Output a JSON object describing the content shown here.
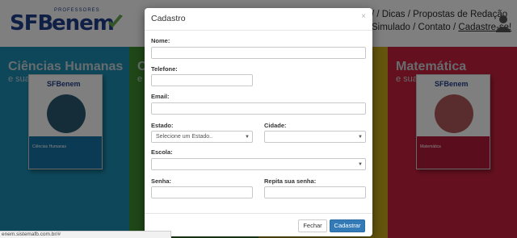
{
  "header": {
    "logo_sfb": "SFB",
    "logo_enem": "enem",
    "logo_tag": "PROFESSORES",
    "nav_line1": "/ / Dicas / Propostas de Redação",
    "nav_line2_a": "Simulado / Contato / ",
    "nav_cadastre": "Cadastre-se!"
  },
  "columns": {
    "humanas_title": "Ciências Humanas",
    "humanas_sub": "e suas Tecnologias",
    "green_title": "C",
    "green_sub": "e",
    "matematica_title": "Matemática",
    "matematica_sub": "e suas Tecnologias",
    "book_humanas_mini": "SFBenem",
    "book_humanas_title": "Ciências Humanas",
    "book_mat_mini": "SFBenem",
    "book_mat_title": "Matemática"
  },
  "modal": {
    "title": "Cadastro",
    "close_glyph": "×",
    "nome_label": "Nome:",
    "telefone_label": "Telefone:",
    "email_label": "Email:",
    "estado_label": "Estado:",
    "estado_value": "Selecione um Estado..",
    "cidade_label": "Cidade:",
    "cidade_value": "",
    "escola_label": "Escola:",
    "escola_value": "",
    "senha_label": "Senha:",
    "repita_label": "Repita sua senha:",
    "fechar_label": "Fechar",
    "cadastrar_label": "Cadastrar"
  },
  "status_bar": {
    "url": "enem.sistemafb.com.br/#"
  },
  "colors": {
    "blue": "#1b8fb3",
    "green": "#3f8f2f",
    "yellow": "#c9a81b",
    "red": "#c9213f",
    "primary_button": "#337ab7",
    "logo": "#1f3f8a"
  }
}
